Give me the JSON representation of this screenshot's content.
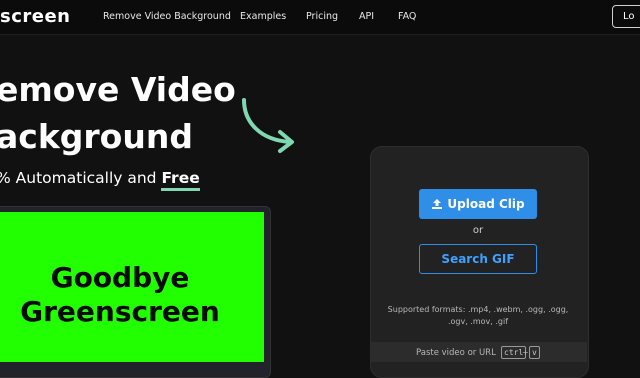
{
  "nav": {
    "logo": "screen",
    "links": [
      "Remove Video Background",
      "Examples",
      "Pricing",
      "API",
      "FAQ"
    ],
    "login": "Lo"
  },
  "hero": {
    "title_line1": "emove Video",
    "title_line2": "ackground",
    "subtitle_prefix": "% Automatically and ",
    "subtitle_free": "Free",
    "accent_color": "#7fd8b1"
  },
  "preview": {
    "line1": "Goodbye",
    "line2": "Greenscreen",
    "bg_color": "#22ff00"
  },
  "upload_card": {
    "upload_label": "Upload Clip",
    "or_label": "or",
    "gif_label": "Search GIF",
    "formats": "Supported formats: .mp4, .webm, .ogg, .ogg, .ogv, .mov, .gif",
    "paste_label": "Paste video or URL",
    "kbd_ctrl": "ctrl",
    "kbd_plus": "+",
    "kbd_v": "v",
    "button_color": "#2f8fe8"
  }
}
